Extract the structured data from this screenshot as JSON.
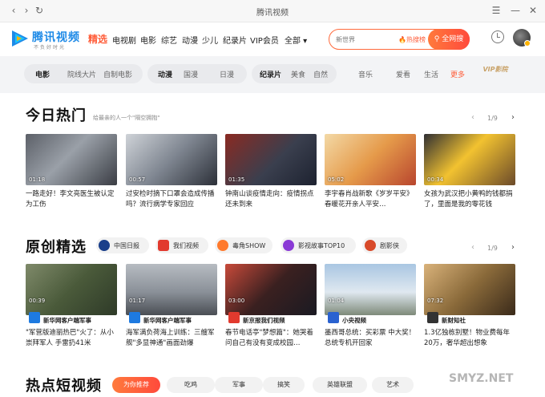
{
  "window": {
    "title": "腾讯视频"
  },
  "brand": {
    "name": "腾讯视频",
    "slogan": "不负好时光"
  },
  "nav": [
    {
      "label": "精选",
      "active": true
    },
    {
      "label": "电视剧"
    },
    {
      "label": "电影"
    },
    {
      "label": "综艺"
    },
    {
      "label": "动漫"
    },
    {
      "label": "少儿"
    },
    {
      "label": "纪录片"
    },
    {
      "label": "VIP会员"
    },
    {
      "label": "全部 ▾"
    }
  ],
  "search": {
    "placeholder": "新世界",
    "hot_label": "热搜榜",
    "button": "全网搜"
  },
  "subnav": {
    "groups": [
      {
        "title": "电影",
        "items": [
          "院线大片",
          "自制电影"
        ]
      },
      {
        "title": "动漫",
        "items": [
          "国漫",
          "日漫"
        ]
      },
      {
        "title": "纪录片",
        "items": [
          "美食",
          "自然"
        ]
      }
    ],
    "plain": [
      "音乐",
      "爱看",
      "生活"
    ],
    "more": "更多",
    "vip": "VIP影院"
  },
  "hot": {
    "title": "今日热门",
    "subtitle": "给最亲的人一个\"隔空拥抱\"",
    "pager": "1/9",
    "cards": [
      {
        "duration": "01:18",
        "caption": "一路走好！李文亮医生被认定为工伤"
      },
      {
        "duration": "00:57",
        "caption": "过安检时摘下口罩会造成传播吗？流行病学专家回应"
      },
      {
        "duration": "01:35",
        "caption": "钟南山谈疫情走向：疫情拐点还未到来"
      },
      {
        "duration": "05:02",
        "caption": "李宇春肖战新歌《岁岁平安》 春暖花开亲人平安…"
      },
      {
        "duration": "00:34",
        "caption": "女孩为武汉把小黄鸭的钱都捐了，里面是我的零花钱"
      }
    ]
  },
  "original": {
    "title": "原创精选",
    "pager": "1/9",
    "channels": [
      "中国日报",
      "我们视频",
      "毒角SHOW",
      "影视故事TOP10",
      "剧影侠"
    ],
    "cards": [
      {
        "duration": "00:39",
        "source": "新华网客户端军事",
        "caption": "\"军营版迪丽热巴\"火了：从小崇拜军人 手雷扔41米"
      },
      {
        "duration": "01:17",
        "source": "新华网客户端军事",
        "caption": "海军满负荷海上训练：三艘军舰\"多显神通\"画面劲爆"
      },
      {
        "duration": "03:00",
        "source": "新京报我们视频",
        "caption": "春节电话亭\"梦想篇\"：她哭着问自己有没有变成校园…"
      },
      {
        "duration": "01:04",
        "source": "小央视频",
        "caption": "墨西哥总统：买彩票 中大奖！总统专机开回家"
      },
      {
        "duration": "07:32",
        "source": "新财知社",
        "caption": "1.3亿独栋别墅！物业费每年20万，奢华超出想象"
      }
    ]
  },
  "shorts": {
    "title": "热点短视频",
    "tabs": [
      "为你推荐",
      "吃鸡",
      "军事",
      "搞笑",
      "英雄联盟",
      "艺术"
    ]
  },
  "watermark": "SMYZ.NET",
  "colors": {
    "accent": "#ff5c38",
    "brand": "#1e8ae7"
  }
}
